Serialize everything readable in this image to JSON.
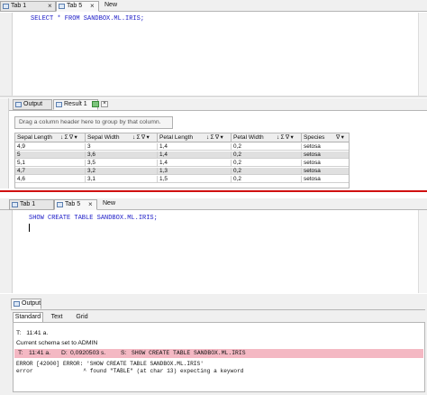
{
  "editor1": {
    "tabs": [
      {
        "label": "Tab 1",
        "active": false
      },
      {
        "label": "Tab 5",
        "active": true
      },
      {
        "label": "New",
        "active": false
      }
    ],
    "close_glyph": "×",
    "query": "SELECT * FROM SANDBOX.ML.IRIS;"
  },
  "result_pane": {
    "tabs": [
      {
        "label": "Output"
      },
      {
        "label": "Result 1"
      }
    ],
    "group_hint": "Drag a column header here to group by that column.",
    "sort_filter_glyph": "↓ Σ ∇ ▾",
    "filter_glyph": "∇ ▾",
    "columns": [
      "Sepal Length",
      "Sepal Width",
      "Petal Length",
      "Petal Width",
      "Species"
    ],
    "rows": [
      [
        "4,9",
        "3",
        "1,4",
        "0,2",
        "setosa"
      ],
      [
        "5",
        "3,6",
        "1,4",
        "0,2",
        "setosa"
      ],
      [
        "5,1",
        "3,5",
        "1,4",
        "0,2",
        "setosa"
      ],
      [
        "4,7",
        "3,2",
        "1,3",
        "0,2",
        "setosa"
      ],
      [
        "4,6",
        "3,1",
        "1,5",
        "0,2",
        "setosa"
      ]
    ]
  },
  "editor2": {
    "tabs": [
      {
        "label": "Tab 1",
        "active": false
      },
      {
        "label": "Tab 5",
        "active": true
      },
      {
        "label": "New",
        "active": false
      }
    ],
    "query": "SHOW CREATE TABLE SANDBOX.ML.IRIS;"
  },
  "output_panel": {
    "title": "Output",
    "tabs": [
      "Standard",
      "Text",
      "Grid"
    ],
    "log": {
      "t_label": "T:",
      "line1_time": "11:41 a.",
      "line2": "Current schema set to ADMIN",
      "err_time": "11:41 a.",
      "d_label": "D:",
      "err_duration": "0,0920503 s.",
      "s_label": "S:",
      "err_statement": "SHOW CREATE TABLE SANDBOX.ML.IRIS",
      "error_line1": "ERROR [42000] ERROR:  'SHOW CREATE TABLE SANDBOX.ML.IRIS'",
      "error_line2": "error               ^ found \"TABLE\" (at char 13) expecting a keyword"
    }
  },
  "colors": {
    "error_row": "#f4b8c3",
    "splitter": "#d01010",
    "sql_keyword": "#2020c8"
  }
}
